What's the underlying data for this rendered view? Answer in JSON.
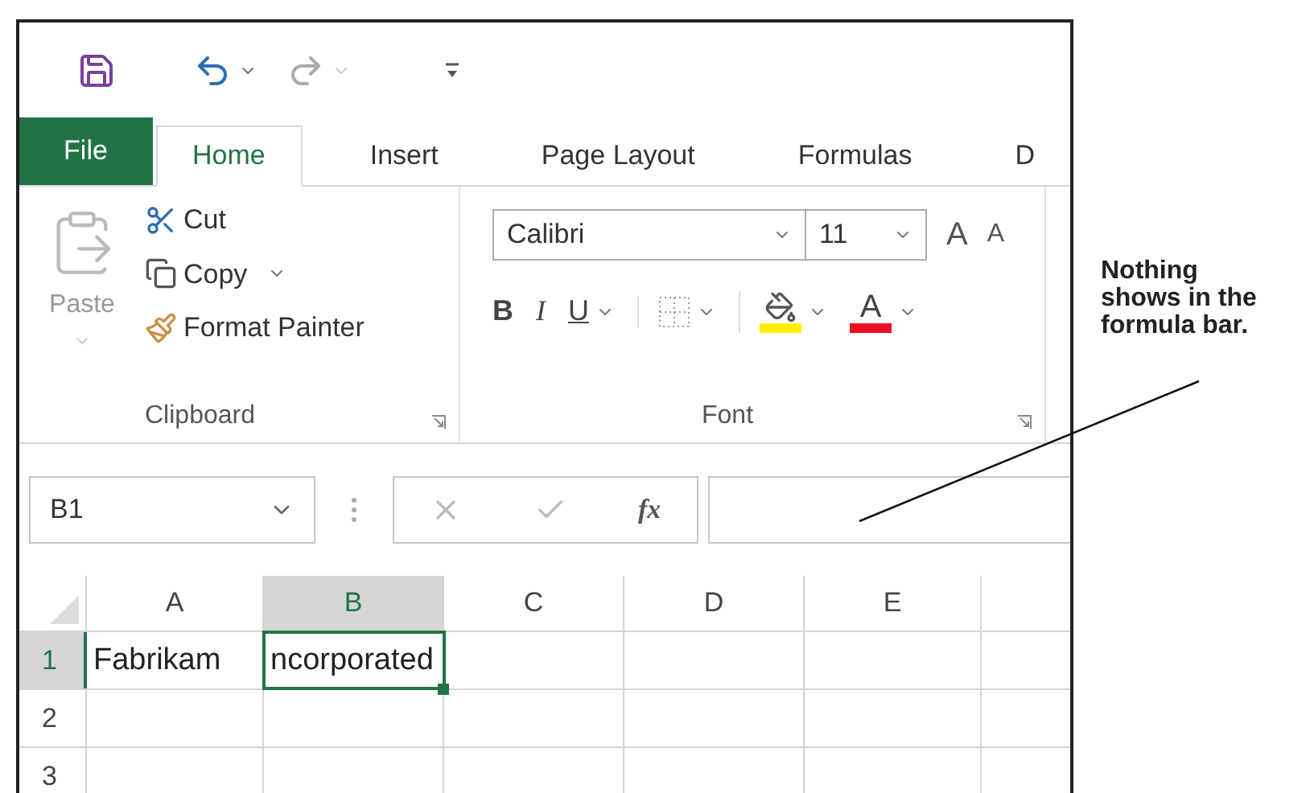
{
  "tabs": [
    {
      "label": "File",
      "kind": "file",
      "selected": false
    },
    {
      "label": "Home",
      "kind": "tab",
      "selected": true
    },
    {
      "label": "Insert",
      "kind": "tab",
      "selected": false
    },
    {
      "label": "Page Layout",
      "kind": "tab",
      "selected": false
    },
    {
      "label": "Formulas",
      "kind": "tab",
      "selected": false
    },
    {
      "label": "D",
      "kind": "tab",
      "selected": false
    }
  ],
  "clipboard": {
    "paste": "Paste",
    "cut": "Cut",
    "copy": "Copy",
    "format_painter": "Format Painter",
    "group_label": "Clipboard"
  },
  "font": {
    "font_name": "Calibri",
    "font_size": "11",
    "grow": "A",
    "shrink": "A",
    "bold": "B",
    "italic": "I",
    "underline": "U",
    "font_color_label": "A",
    "group_label": "Font"
  },
  "formula_bar": {
    "name_box": "B1",
    "function_label": "fx"
  },
  "grid": {
    "columns": [
      {
        "label": "A",
        "selected": false
      },
      {
        "label": "B",
        "selected": true
      },
      {
        "label": "C",
        "selected": false
      },
      {
        "label": "D",
        "selected": false
      },
      {
        "label": "E",
        "selected": false
      }
    ],
    "rows": [
      {
        "label": "1",
        "selected": true,
        "cells": [
          "Fabrikam",
          "ncorporated",
          "",
          "",
          ""
        ]
      },
      {
        "label": "2",
        "selected": false,
        "cells": [
          "",
          "",
          "",
          "",
          ""
        ]
      },
      {
        "label": "3",
        "selected": false,
        "cells": [
          "",
          "",
          "",
          "",
          ""
        ]
      }
    ]
  },
  "callout": "Nothing shows in the formula bar."
}
